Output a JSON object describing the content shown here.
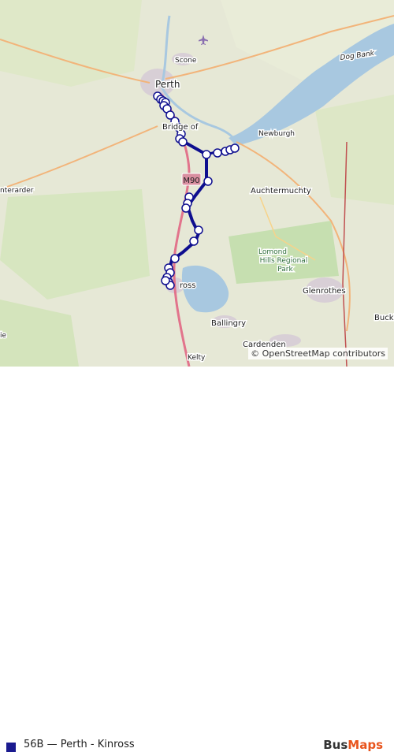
{
  "map": {
    "places": [
      {
        "name": "Perth",
        "type": "town"
      },
      {
        "name": "Scone",
        "type": "village"
      },
      {
        "name": "Bridge of",
        "type": "village"
      },
      {
        "name": "Newburgh",
        "type": "village"
      },
      {
        "name": "Dog Bank",
        "type": "water"
      },
      {
        "name": "nterarder",
        "type": "village"
      },
      {
        "name": "Auchtermuchty",
        "type": "village"
      },
      {
        "name": "Lomond Hills Regional Park",
        "type": "park"
      },
      {
        "name": "ross",
        "type": "town"
      },
      {
        "name": "Glenrothes",
        "type": "town"
      },
      {
        "name": "Ballingry",
        "type": "village"
      },
      {
        "name": "Cardenden",
        "type": "village"
      },
      {
        "name": "Kelty",
        "type": "village"
      },
      {
        "name": "Buckh",
        "type": "village"
      },
      {
        "name": "ie",
        "type": "village"
      }
    ],
    "road_shield": "M90",
    "airport_icon": "airport-icon",
    "colors": {
      "route": "#0e0e8f",
      "stop_fill": "#ffffff",
      "water": "#a8c8e0",
      "land": "#e6e8d6",
      "urban": "#d8cfd6"
    },
    "attribution": "© OpenStreetMap contributors"
  },
  "legend": {
    "label": "56B — Perth - Kinross",
    "color": "#1a1a8f"
  },
  "brand": {
    "part1": "Bus",
    "part2": "Maps"
  }
}
